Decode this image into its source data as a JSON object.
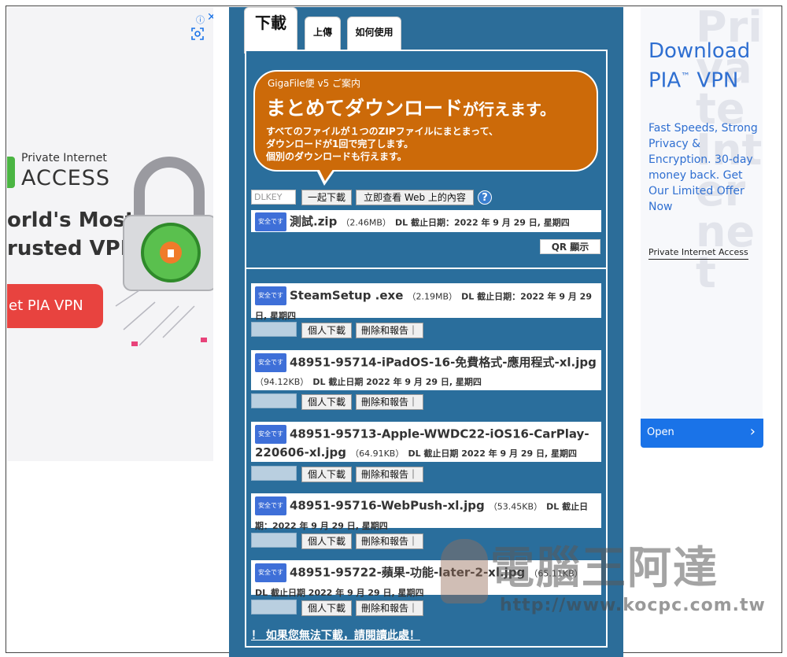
{
  "left_ad": {
    "brand_top": "Private Internet",
    "brand_main": "ACCESS",
    "slogan_line1": "orld's Most",
    "slogan_line2": "rusted VPN",
    "cta": "et PIA VPN",
    "info_icon": "info-icon",
    "close_icon": "close-icon"
  },
  "tabs": {
    "download": "下載",
    "upload": "上傳",
    "howto": "如何使用"
  },
  "bubble": {
    "small": "GigaFile便 v5 ご案内",
    "big_main": "まとめてダウンロード",
    "big_tail": "が行えます。",
    "line1": "すべてのファイルが１つのZIPファイルにまとまって、",
    "line2": "ダウンロードが1回で完了します。",
    "line3": "個別のダウンロードも行えます。"
  },
  "controls": {
    "dlkey_placeholder": "DLKEY",
    "download_all": "一起下載",
    "view_web": "立即查看 Web 上的內容",
    "help": "?"
  },
  "safe_badge": "安全です",
  "zip": {
    "name": "測試.zip",
    "size": "（2.46MB）",
    "expiry": "DL 截止日期：2022 年 9 月 29 日, 星期四"
  },
  "qr_label": "QR 顯示",
  "files": [
    {
      "name": "SteamSetup .exe",
      "size": "（2.19MB）",
      "expiry": "DL 截止日期：2022 年 9 月 29 日, 星期四"
    },
    {
      "name": "48951-95714-iPadOS-16-免費格式-應用程式-xl.jpg",
      "size": "（94.12KB）",
      "expiry": "DL 截止日期 2022 年 9 月 29 日, 星期四"
    },
    {
      "name": "48951-95713-Apple-WWDC22-iOS16-CarPlay-220606-xl.jpg",
      "size": "（64.91KB）",
      "expiry": "DL 截止日期 2022 年 9 月 29 日, 星期四"
    },
    {
      "name": "48951-95716-WebPush-xl.jpg",
      "size": "（53.45KB）",
      "expiry": "DL 截止日期：2022 年 9 月 29 日, 星期四"
    },
    {
      "name": "48951-95722-蘋果-功能-later-2-xl.jpg",
      "size": "（65.11KB）",
      "expiry": "DL 截止日期 2022 年 9 月 29 日, 星期四"
    }
  ],
  "file_buttons": {
    "individual": "個人下載",
    "delete": "刪除和報告｜"
  },
  "cant_download": "！ 如果您無法下載，請閱讀此處！",
  "watermark": {
    "title": "電腦王阿達",
    "url": "http://www.kocpc.com.tw"
  },
  "right_ad": {
    "headline_line1": "Download",
    "headline_line2": "PIA",
    "headline_tm": "™",
    "headline_line2b": " VPN",
    "description": "Fast Speeds, Strong Privacy & Encryption. 30-day money back. Get Our Limited Offer Now",
    "brand": "Private Internet Access",
    "open_label": "Open",
    "bg_text": "Private Internet"
  },
  "colors": {
    "panel_blue": "#2a6e9c",
    "bubble_orange": "#cc6a09",
    "safe_badge_blue": "#3e6fd8",
    "ad_blue": "#1a73e8",
    "pia_red": "#e8433f",
    "pia_green": "#4bb543"
  }
}
